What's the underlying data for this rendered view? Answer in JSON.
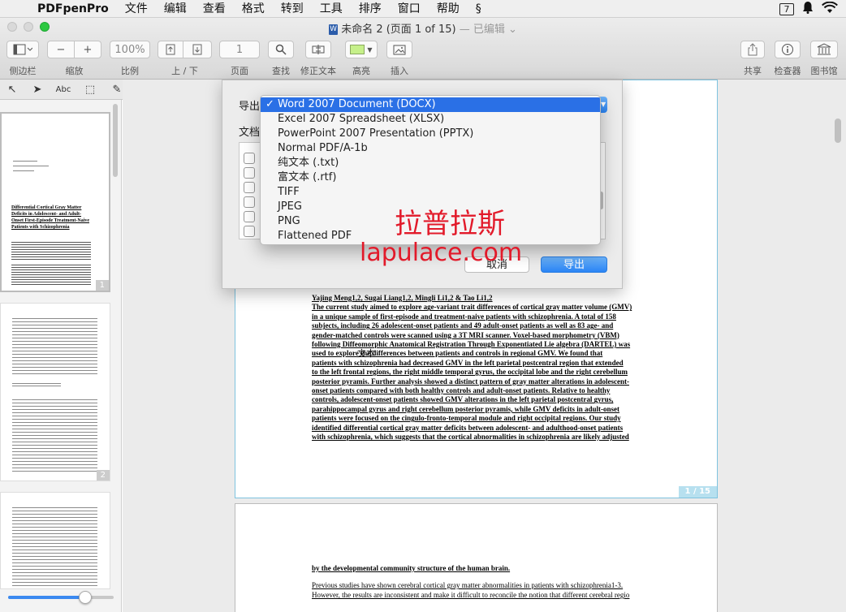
{
  "menubar": {
    "app_name": "PDFpenPro",
    "items": [
      "文件",
      "编辑",
      "查看",
      "格式",
      "转到",
      "工具",
      "排序",
      "窗口",
      "帮助"
    ],
    "status_num": "7"
  },
  "window": {
    "title": "未命名 2 (页面 1 of 15)",
    "title_suffix": "— 已编辑 ⌄"
  },
  "toolbar": {
    "zoom_value": "100%",
    "page_value": "1",
    "labels": {
      "sidebar": "侧边栏",
      "zoom": "缩放",
      "scale": "比例",
      "updown": "上 / 下",
      "page": "页面",
      "find": "查找",
      "fix_text": "修正文本",
      "highlight": "高亮",
      "insert": "插入",
      "share": "共享",
      "inspector": "检查器",
      "library": "图书馆"
    }
  },
  "sidebar": {
    "thumb1_title": "Differential Cortical Gray Matter Deficits in Adolescent- and Adult-Onset First-Episode Treatment-Naive Patients with Schizophrenia",
    "page_numbers": [
      "1",
      "2"
    ]
  },
  "dialog": {
    "export_label": "导出",
    "docs_label": "文档",
    "cancel_label": "取消",
    "export_button": "导出",
    "formats": [
      "Word 2007 Document (DOCX)",
      "Excel 2007 Spreadsheet (XLSX)",
      "PowerPoint 2007 Presentation (PPTX)",
      "Normal PDF/A-1b",
      "纯文本 (.txt)",
      "富文本 (.rtf)",
      "TIFF",
      "JPEG",
      "PNG",
      "Flattened PDF"
    ],
    "selected_index": 0,
    "check_mark": "✓"
  },
  "watermark": {
    "line1": "拉普拉斯",
    "line2": "lapulace.com"
  },
  "document": {
    "page1_lines": [
      "Yajing Meng1,2, Sugai Liang1,2, Mingli Li1,2 & Tao Li1,2",
      "The current study aimed to explore age-variant trait differences of cortical gray matter volume (GMV)",
      "in a unique sample of first-episode and treatment-naive patients with schizophrenia. A total of 158",
      "subjects, including 26 adolescent-onset patients and 49 adult-onset patients as well as 83 age- and",
      "gender-matched controls were scanned using a 3T MRI scanner. Voxel-based morphometry (VBM)",
      "following Diffeomorphic Anatomical Registration Through Exponentiated Lie algebra (DARTEL) was",
      "used to explore the differences between patients and controls in regional GMV. We found that",
      "patients with schizophrenia had decreased GMV in the left parietal postcentral region that extended",
      "to the left frontal regions, the right middle temporal gyrus, the occipital lobe and the right cerebellum",
      "posterior pyramis. Further analysis showed a distinct pattern of gray matter alterations in adolescent-",
      "onset patients compared with both healthy controls and adult-onset patients. Relative to healthy",
      "controls, adolescent-onset patients showed GMV alterations in the left parietal postcentral gyrus,",
      "parahippocampal gyrus and right cerebellum posterior pyramis, while GMV deficits in adult-onset",
      "patients were focused on the cingulo-fronto-temporal module and right occipital regions. Our study",
      "identified differential cortical gray matter deficits between adolescent- and adulthood-onset patients",
      "with schizophrenia, which suggests that the cortical abnormalities in schizophrenia are likely adjusted"
    ],
    "page1_badge": "1 / 15",
    "page2_heading": "by the developmental community structure of the human brain.",
    "page2_lines": [
      "Previous studies have shown cerebral cortical gray matter abnormalities in patients with schizophrenia1-3.",
      "However, the results are inconsistent and make it difficult to reconcile the notion that different cerebral regio"
    ],
    "cursor_text": "文本"
  }
}
